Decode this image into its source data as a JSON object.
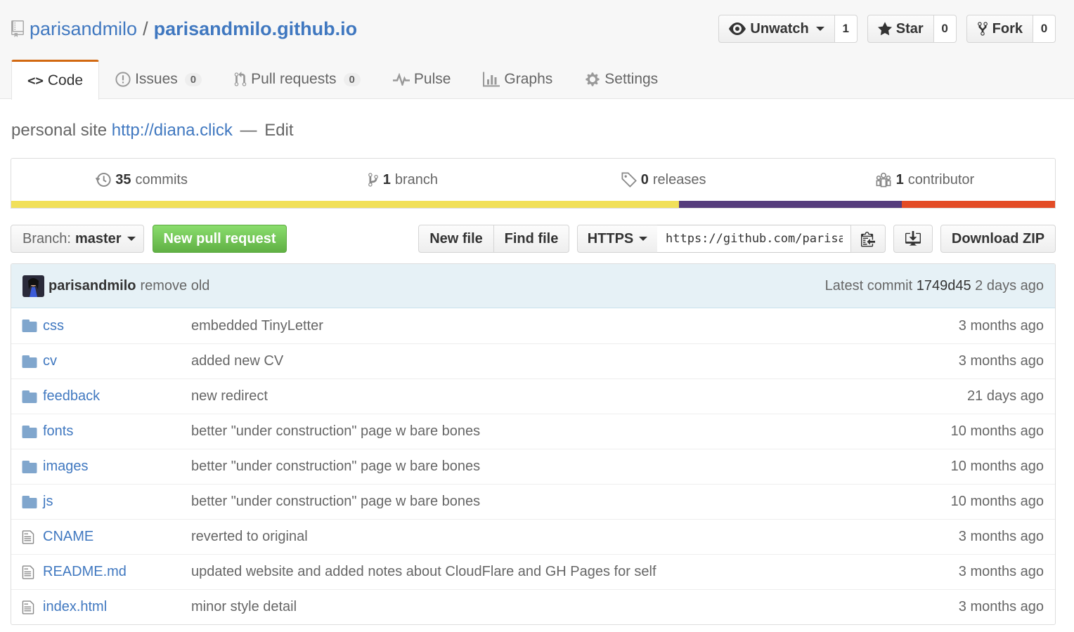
{
  "repo": {
    "owner": "parisandmilo",
    "separator": "/",
    "name": "parisandmilo.github.io"
  },
  "actions": {
    "watch": {
      "label": "Unwatch",
      "count": "1"
    },
    "star": {
      "label": "Star",
      "count": "0"
    },
    "fork": {
      "label": "Fork",
      "count": "0"
    }
  },
  "tabs": [
    {
      "label": "Code",
      "icon": "code-icon"
    },
    {
      "label": "Issues",
      "icon": "issue-icon",
      "count": "0"
    },
    {
      "label": "Pull requests",
      "icon": "pull-request-icon",
      "count": "0"
    },
    {
      "label": "Pulse",
      "icon": "pulse-icon"
    },
    {
      "label": "Graphs",
      "icon": "graph-icon"
    },
    {
      "label": "Settings",
      "icon": "gear-icon"
    }
  ],
  "description": {
    "text": "personal site",
    "url": "http://diana.click",
    "edit_sep": "—",
    "edit": "Edit"
  },
  "summary": {
    "commits": {
      "num": "35",
      "label": "commits"
    },
    "branches": {
      "num": "1",
      "label": "branch"
    },
    "releases": {
      "num": "0",
      "label": "releases"
    },
    "contributors": {
      "num": "1",
      "label": "contributor"
    }
  },
  "languages": [
    {
      "color": "#f1e05a",
      "percent": 64
    },
    {
      "color": "#563d7c",
      "percent": 21.3
    },
    {
      "color": "#e34c26",
      "percent": 14.7
    }
  ],
  "filebar": {
    "branch_label": "Branch:",
    "branch_name": "master",
    "new_pr": "New pull request",
    "new_file": "New file",
    "find_file": "Find file",
    "protocol": "HTTPS",
    "clone_url": "https://github.com/parisandmilo/parisandmilo.github.io.git",
    "download": "Download ZIP"
  },
  "commit": {
    "author": "parisandmilo",
    "message": "remove old",
    "latest_label": "Latest commit",
    "sha": "1749d45",
    "age": "2 days ago"
  },
  "files": [
    {
      "type": "dir",
      "name": "css",
      "message": "embedded TinyLetter",
      "age": "3 months ago"
    },
    {
      "type": "dir",
      "name": "cv",
      "message": "added new CV",
      "age": "3 months ago"
    },
    {
      "type": "dir",
      "name": "feedback",
      "message": "new redirect",
      "age": "21 days ago"
    },
    {
      "type": "dir",
      "name": "fonts",
      "message": "better \"under construction\" page w bare bones",
      "age": "10 months ago"
    },
    {
      "type": "dir",
      "name": "images",
      "message": "better \"under construction\" page w bare bones",
      "age": "10 months ago"
    },
    {
      "type": "dir",
      "name": "js",
      "message": "better \"under construction\" page w bare bones",
      "age": "10 months ago"
    },
    {
      "type": "file",
      "name": "CNAME",
      "message": "reverted to original",
      "age": "3 months ago"
    },
    {
      "type": "file",
      "name": "README.md",
      "message": "updated website and added notes about CloudFlare and GH Pages for self",
      "age": "3 months ago"
    },
    {
      "type": "file",
      "name": "index.html",
      "message": "minor style detail",
      "age": "3 months ago"
    }
  ]
}
